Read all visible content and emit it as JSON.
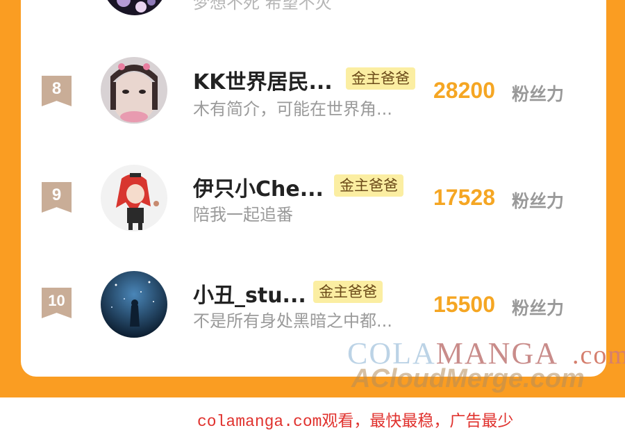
{
  "top_row": {
    "desc": "梦想不死 希望不灭"
  },
  "rows": [
    {
      "rank": "8",
      "name": "KK世界居民...",
      "tag": "金主爸爸",
      "desc": "木有简介，可能在世界角...",
      "fans": "28200"
    },
    {
      "rank": "9",
      "name": "伊只小Che...",
      "tag": "金主爸爸",
      "desc": "陪我一起追番",
      "fans": "17528"
    },
    {
      "rank": "10",
      "name": "小丑_stu...",
      "tag": "金主爸爸",
      "desc": "不是所有身处黑暗之中都...",
      "fans": "15500"
    }
  ],
  "fans_label": "粉丝力",
  "watermark": {
    "part1": "COLA",
    "part2": "MANGA",
    "part3": ".com",
    "line2": "ACloudMerge.com"
  },
  "footer_text": "colamanga.com观看，最快最稳，广告最少",
  "colors": {
    "frame": "#fa9d22",
    "fans": "#f5a623",
    "tag_bg": "#fbeea2",
    "badge": "#c9ad97",
    "footer": "#e0322e"
  }
}
